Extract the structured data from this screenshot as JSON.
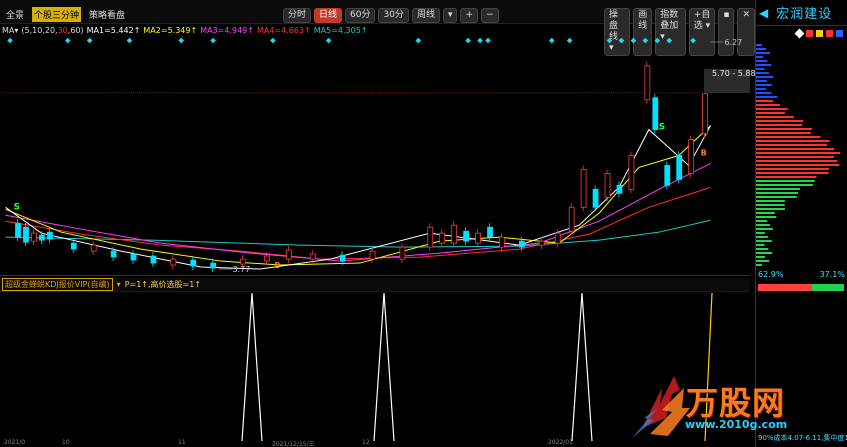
{
  "toolbar": {
    "left_tabs": [
      "全景",
      "个股三分钟",
      "策略看盘"
    ],
    "left_active": 1,
    "period_buttons": [
      "分时",
      "日线",
      "60分",
      "30分",
      "周线"
    ],
    "period_active": 1,
    "period_more": "▾",
    "zoom_plus": "+",
    "zoom_minus": "−",
    "right_buttons": [
      "操盘线 ▾",
      "画线",
      "指数叠加 ▾",
      "+自选 ▾"
    ],
    "win_controls": [
      "▪",
      "✕"
    ]
  },
  "ma_legend": {
    "prefix": "MA▾",
    "params_prefix": "(5,10,20,",
    "params_highlight": "30",
    "params_suffix": ",60)",
    "ma1": "MA1=5.442↑",
    "ma2": "MA2=5.349↑",
    "ma3": "MA3=4.949↑",
    "ma4": "MA4=4.663↑",
    "ma5": "MA5=4.305↑"
  },
  "price_labels": {
    "high": "6.27",
    "range": "5.70 - 5.88",
    "low": "3.77"
  },
  "signals": {
    "sell": "S",
    "buy": "B"
  },
  "indicator": {
    "name": "超级金蝉蜕KDJ报价VIP(自编)",
    "dropdown": "▾",
    "values": "P=1↑,高价选股=1↑"
  },
  "sidebar": {
    "arrow_left": "◀",
    "title": "宏润建设",
    "pct_left": "62.9%",
    "pct_right": "37.1%",
    "cost_text": "90%成本4.07-6.11,集中度1"
  },
  "dates": [
    "2021/0",
    "10",
    "11",
    "2021/12/15/三",
    "12",
    "2022/01"
  ],
  "watermark": {
    "text": "万股网",
    "url": "www.2010g.com"
  },
  "colors": {
    "up": "#ff3b3b",
    "down": "#00e0ff",
    "ma1": "#ffffff",
    "ma2": "#ffff00",
    "ma3": "#ff40ff",
    "ma4": "#ff3030",
    "ma5": "#20c8c8"
  }
}
